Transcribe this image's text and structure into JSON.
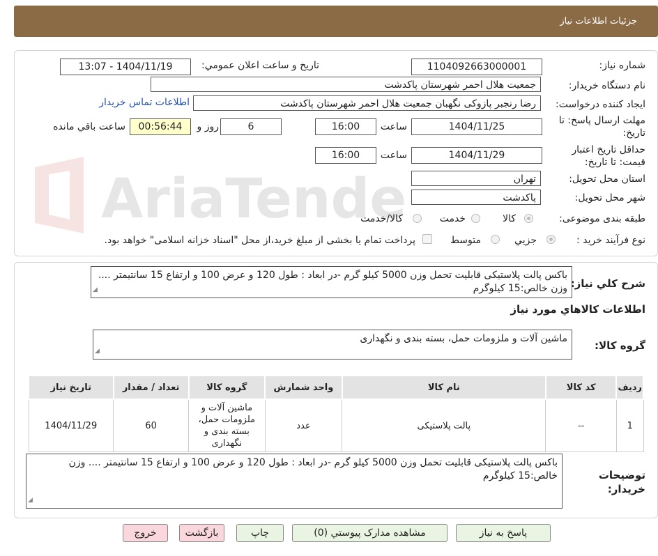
{
  "header": {
    "title": "جزئیات اطلاعات نیاز"
  },
  "watermark": {
    "text": "AriaTender.neT"
  },
  "form": {
    "need_number_label": "شماره نیاز:",
    "need_number": "1104092663000001",
    "announce_label": "تاریخ و ساعت اعلان عمومي:",
    "announce_value": "1404/11/19 - 13:07",
    "buyer_org_label": "نام دستگاه خریدار:",
    "buyer_org": "جمعیت هلال احمر شهرستان پاکدشت",
    "creator_label": "ایجاد کننده درخواست:",
    "creator": "رضا  رنجبر پازوکی  نگهبان  جمعیت هلال احمر شهرستان پاکدشت",
    "contact_link": "اطلاعات تماس خریدار",
    "deadline_label": "مهلت ارسال پاسخ: تا تاریخ:",
    "deadline_date": "1404/11/25",
    "time_label": "ساعت",
    "deadline_time": "16:00",
    "days_value": "6",
    "days_label": "روز و",
    "remaining_time": "00:56:44",
    "remaining_label": "ساعت باقي مانده",
    "validity_label": "حداقل تاریخ اعتبار قیمت: تا تاریخ:",
    "validity_date": "1404/11/29",
    "validity_time": "16:00",
    "province_label": "استان محل تحویل:",
    "province": "تهران",
    "city_label": "شهر محل تحویل:",
    "city": "پاکدشت",
    "category_label": "طبقه بندی موضوعی:",
    "category_options": [
      "کالا",
      "خدمت",
      "کالا/خدمت"
    ],
    "category_selected": "کالا",
    "process_label": "نوع فرآیند خرید :",
    "process_options": [
      "جزیي",
      "متوسط"
    ],
    "process_selected": "جزیي",
    "payment_note": "پرداخت تمام یا بخشی از مبلغ خرید،از محل \"اسناد خزانه اسلامی\" خواهد بود."
  },
  "details": {
    "summary_label": "شرح كلي نياز:",
    "summary": "باکس پالت پلاستیکی قابلیت تحمل وزن 5000 کیلو گرم -در ابعاد : طول 120 و عرض 100 و ارتفاع 15 سانتیمتر .... وزن خالص:15 کیلوگرم",
    "items_title": "اطلاعات كالاهاي مورد نياز",
    "group_label": "گروه کالا:",
    "group_value": "ماشین آلات و ملزومات حمل، بسته بندی و نگهداری",
    "table": {
      "headers": [
        "ردیف",
        "کد کالا",
        "نام کالا",
        "واحد شمارش",
        "گروه کالا",
        "تعداد / مقدار",
        "تاریخ نیاز"
      ],
      "rows": [
        [
          "1",
          "--",
          "پالت پلاستیکی",
          "عدد",
          "ماشین آلات و ملزومات حمل، بسته بندی و نگهداری",
          "60",
          "1404/11/29"
        ]
      ]
    },
    "buyer_notes_label": "توضیحات خریدار:",
    "buyer_notes": "باکس پالت پلاستیکی قابلیت تحمل وزن 5000 کیلو گرم -در ابعاد : طول 120 و عرض 100 و ارتفاع 15 سانتیمتر .... وزن خالص:15 کیلوگرم"
  },
  "buttons": {
    "reply": "پاسخ به نیاز",
    "attachments": "مشاهده مدارک پیوستي (0)",
    "print": "چاپ",
    "back": "بازگشت",
    "exit": "خروج"
  }
}
